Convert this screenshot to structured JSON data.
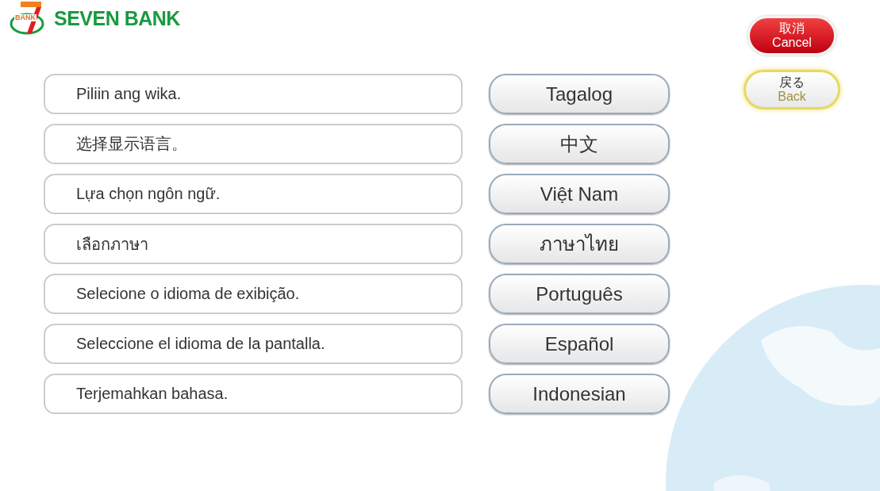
{
  "logo": {
    "badge": "BANK",
    "name": "SEVEN BANK"
  },
  "actions": [
    {
      "kind": "cancel",
      "label": "取消",
      "sublabel": "Cancel"
    },
    {
      "kind": "back",
      "label": "戻る",
      "sublabel": "Back"
    }
  ],
  "languages": [
    {
      "prompt": "Piliin ang wika.",
      "language": "Tagalog"
    },
    {
      "prompt": "选择显示语言。",
      "language": "中文"
    },
    {
      "prompt": "Lựa chọn ngôn ngữ.",
      "language": "Việt Nam"
    },
    {
      "prompt": "เลือกภาษา",
      "language": "ภาษาไทย"
    },
    {
      "prompt": "Selecione o idioma de exibição.",
      "language": "Português"
    },
    {
      "prompt": "Seleccione el idioma de la pantalla.",
      "language": "Español"
    },
    {
      "prompt": "Terjemahkan bahasa.",
      "language": "Indonesian"
    }
  ]
}
